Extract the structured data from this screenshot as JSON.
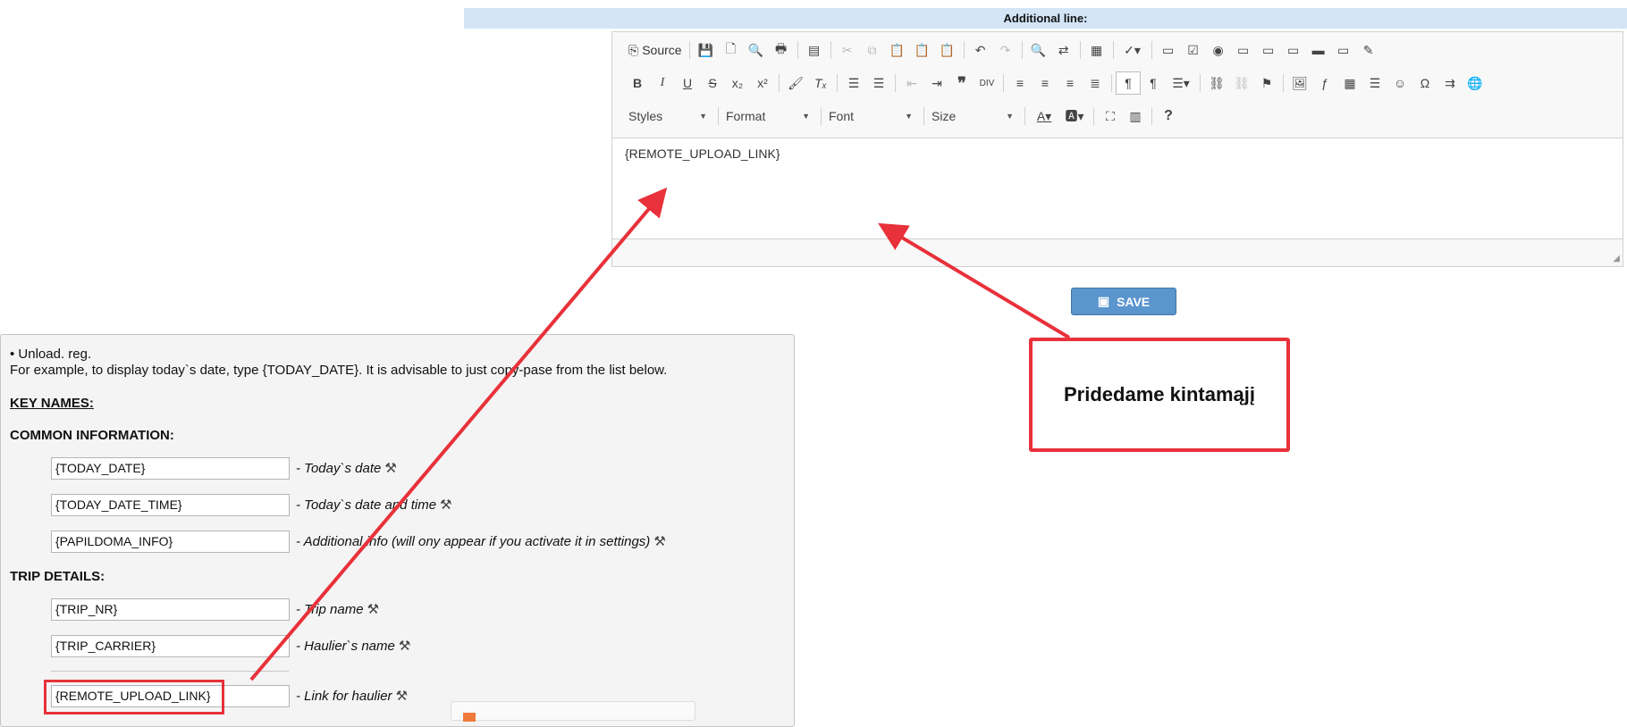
{
  "header": {
    "title": "Additional line:"
  },
  "editor": {
    "source_label": "Source",
    "combos": {
      "styles": "Styles",
      "format": "Format",
      "font": "Font",
      "size": "Size"
    },
    "content": "{REMOTE_UPLOAD_LINK}",
    "help": "?"
  },
  "save_button": {
    "label": "SAVE"
  },
  "annotation": {
    "text": "Pridedame kintamąjį"
  },
  "panel": {
    "line1": "• Unload. reg.",
    "line2": "For example, to display today`s date, type {TODAY_DATE}. It is advisable to just copy-pase from the list below.",
    "key_names": "KEY NAMES:",
    "common_heading": "COMMON INFORMATION:",
    "trip_heading": "TRIP DETAILS:",
    "vars": [
      {
        "value": "{TODAY_DATE}",
        "desc": "- Today`s date"
      },
      {
        "value": "{TODAY_DATE_TIME}",
        "desc": "- Today`s date and time"
      },
      {
        "value": "{PAPILDOMA_INFO}",
        "desc": "- Additional info (will ony appear if you activate it in settings)"
      },
      {
        "value": "{TRIP_NR}",
        "desc": "- Trip name"
      },
      {
        "value": "{TRIP_CARRIER}",
        "desc": "- Haulier`s name"
      },
      {
        "value": "{REMOTE_UPLOAD_LINK}",
        "desc": "- Link for haulier"
      }
    ]
  }
}
